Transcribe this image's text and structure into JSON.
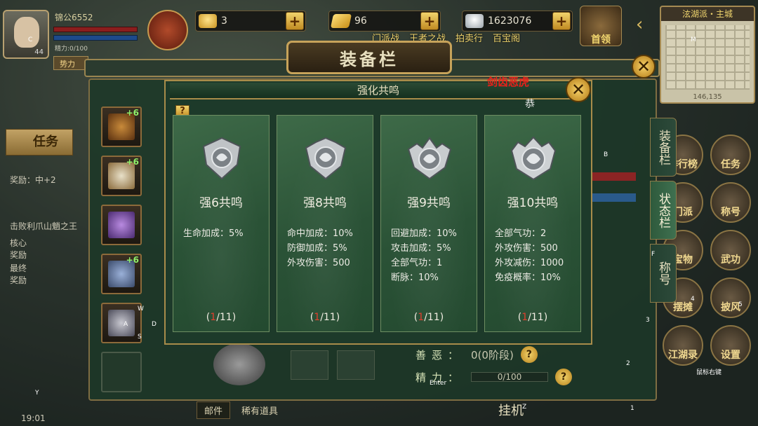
{
  "player": {
    "name": "锦公6552",
    "hp": "1197/1197",
    "mp": "452/452",
    "exp": "精力:0/100",
    "level": "44",
    "force_tag": "势力"
  },
  "currencies": [
    {
      "icon": "gold-ingot-icon",
      "value": "3"
    },
    {
      "icon": "gold-bar-icon",
      "value": "96"
    },
    {
      "icon": "silver-ingot-icon",
      "value": "1623076"
    }
  ],
  "top_menu": [
    "门派战",
    "王者之战",
    "拍卖行",
    "百宝阁"
  ],
  "leader_label": "首领",
  "minimap": {
    "title": "泫湖派・主城",
    "coord": "146,135"
  },
  "equipment_panel": {
    "title": "装备栏",
    "side_tabs": [
      "装备栏",
      "状态栏",
      "称号"
    ],
    "slots": [
      {
        "name": "bow",
        "plus": "+6"
      },
      {
        "name": "armor",
        "plus": "+6"
      },
      {
        "name": "ornament",
        "plus": ""
      },
      {
        "name": "ring",
        "plus": "+6"
      },
      {
        "name": "weapon",
        "plus": ""
      },
      {
        "name": "empty",
        "plus": ""
      }
    ],
    "info": {
      "label1": "善恶：",
      "value1": "0(0阶段)",
      "label2": "精力：",
      "value2": "0/100"
    }
  },
  "dialog": {
    "title": "强化共鸣",
    "help": "?",
    "overlay_red": "剑齿恶虎",
    "overlay_white": "恭",
    "cards": [
      {
        "title": "强6共鸣",
        "stats": [
          "生命加成：5%"
        ],
        "progress_cur": "1",
        "progress_total": "/11"
      },
      {
        "title": "强8共鸣",
        "stats": [
          "命中加成：10%",
          "防御加成：5%",
          "外攻伤害：500"
        ],
        "progress_cur": "1",
        "progress_total": "/11"
      },
      {
        "title": "强9共鸣",
        "stats": [
          "回避加成：10%",
          "攻击加成：5%",
          "全部气功：1",
          "断脉：10%"
        ],
        "progress_cur": "1",
        "progress_total": "/11"
      },
      {
        "title": "强10共鸣",
        "stats": [
          "全部气功：2",
          "外攻伤害：500",
          "外攻减伤：1000",
          "免疫概率：10%"
        ],
        "progress_cur": "1",
        "progress_total": "/11"
      }
    ]
  },
  "left_panel": {
    "quest_btn": "任务",
    "reward_text": "奖励：中+2",
    "quest_text": "击败利爪山魈之王",
    "core_reward": "核心奖励",
    "final_reward": "最终奖励"
  },
  "right_buttons": [
    "排行榜",
    "任务",
    "门派",
    "称号",
    "宝物",
    "武功",
    "摆摊",
    "披风",
    "江湖录",
    "设置"
  ],
  "bottom": {
    "mail": "邮件",
    "rare": "稀有道具",
    "hang": "挂机",
    "time": "19:01"
  },
  "key_hints": [
    "C",
    "M",
    "B",
    "F",
    "W",
    "A",
    "S",
    "D",
    "Y",
    "Z",
    "1",
    "2",
    "3",
    "4",
    "5",
    "Enter",
    "鼠标右键"
  ]
}
